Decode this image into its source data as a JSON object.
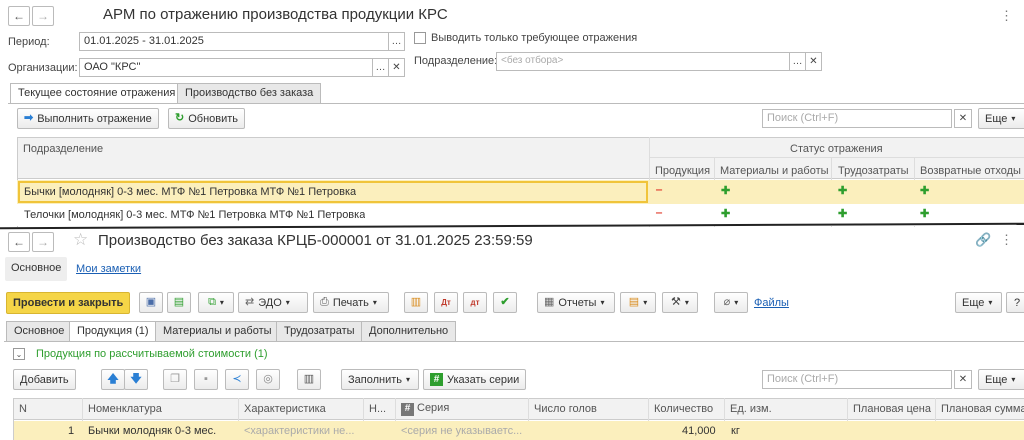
{
  "top": {
    "title": "АРМ по отражению производства продукции КРС",
    "period_label": "Период:",
    "period_value": "01.01.2025 - 31.01.2025",
    "org_label": "Организации:",
    "org_value": "ОАО \"КРС\"",
    "checkbox_label": "Выводить только требующее отражения",
    "subdiv_label": "Подразделение:",
    "subdiv_placeholder": "<без отбора>",
    "tabs": [
      "Текущее состояние отражения",
      "Производство без заказа"
    ],
    "btn_execute": "Выполнить отражение",
    "btn_refresh": "Обновить",
    "search_placeholder": "Поиск (Ctrl+F)",
    "more": "Еще",
    "table": {
      "col_subdiv": "Подразделение",
      "col_status": "Статус отражения",
      "sub_cols": [
        "Продукция",
        "Материалы и работы",
        "Трудозатраты",
        "Возвратные отходы"
      ],
      "rows": [
        {
          "name": "Бычки [молодняк] 0-3 мес. МТФ №1 Петровка МТФ №1 Петровка"
        },
        {
          "name": "Телочки [молодняк] 0-3 мес. МТФ №1 Петровка МТФ №1 Петровка"
        }
      ]
    }
  },
  "doc": {
    "title": "Производство без заказа КРЦБ-000001 от 31.01.2025 23:59:59",
    "nav_main": "Основное",
    "nav_notes": "Мои заметки",
    "btn_post_close": "Провести и закрыть",
    "btn_edo": "ЭДО",
    "btn_print": "Печать",
    "btn_reports": "Отчеты",
    "files_link": "Файлы",
    "more": "Еще",
    "help": "?",
    "tabs": [
      "Основное",
      "Продукция (1)",
      "Материалы и работы",
      "Трудозатраты",
      "Дополнительно"
    ],
    "group_label": "Продукция по рассчитываемой стоимости (1)",
    "btn_add": "Добавить",
    "btn_fill": "Заполнить",
    "btn_series": "Указать серии",
    "search_placeholder": "Поиск (Ctrl+F)",
    "table": {
      "cols": [
        "N",
        "Номенклатура",
        "Характеристика",
        "Н...",
        "Серия",
        "Число голов",
        "Количество",
        "Ед. изм.",
        "Плановая цена",
        "Плановая сумма"
      ],
      "row": {
        "n": "1",
        "nom": "Бычки молодняк 0-3 мес.",
        "char": "<характеристики не...",
        "series": "<серия не указываетс...",
        "qty": "41,000",
        "unit": "кг"
      }
    }
  },
  "colors": {
    "accent_yellow": "#f5d547",
    "selected_row": "#fbefbd",
    "green": "#2e9e2e",
    "red": "#e0392a"
  }
}
